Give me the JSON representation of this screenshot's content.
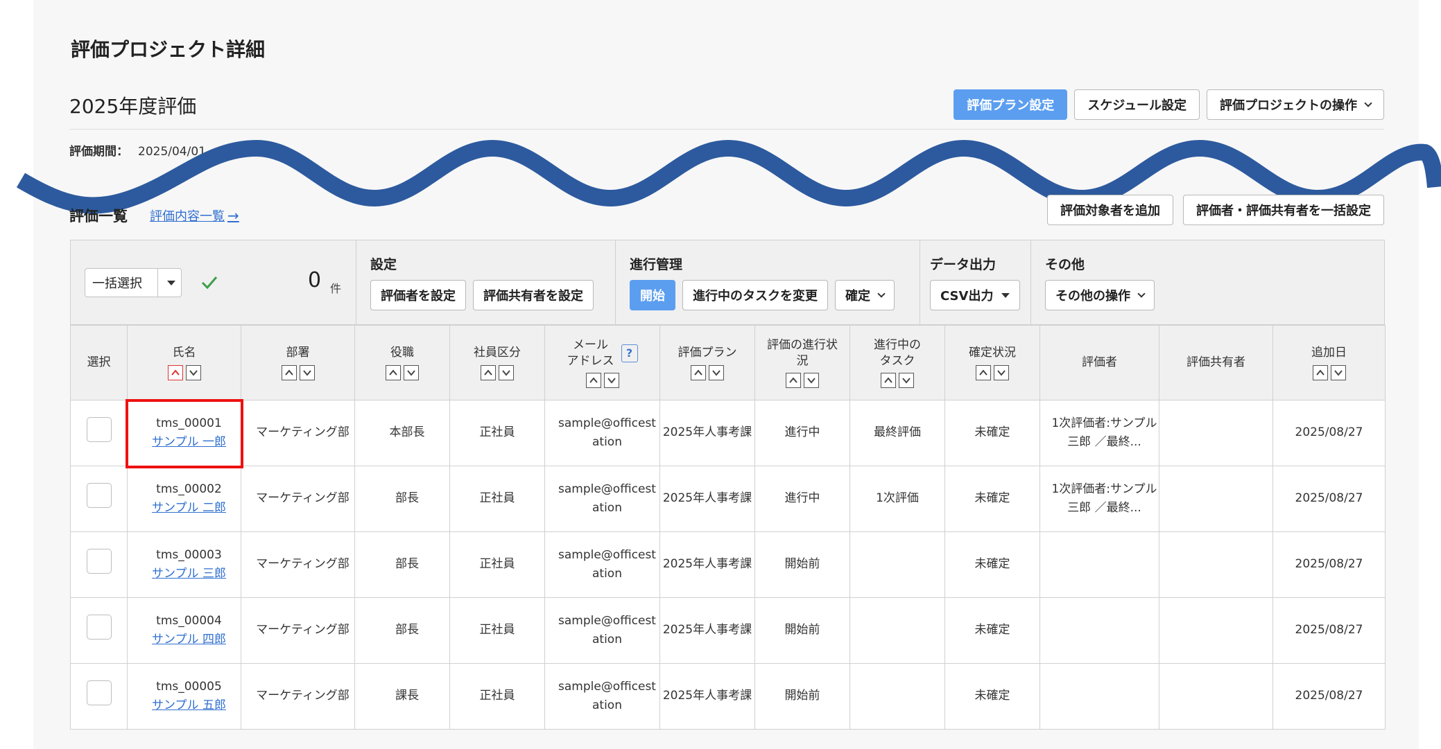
{
  "page_title": "評価プロジェクト詳細",
  "project": {
    "name": "2025年度評価",
    "period_label": "評価期間：",
    "period_value": "2025/04/01 ~2025/09/30"
  },
  "top_actions": {
    "plan_settings": "評価プラン設定",
    "schedule_settings": "スケジュール設定",
    "project_operations": "評価プロジェクトの操作"
  },
  "list": {
    "title": "評価一覧",
    "content_link": "評価内容一覧",
    "add_target": "評価対象者を追加",
    "bulk_set": "評価者・評価共有者を一括設定"
  },
  "toolbar": {
    "bulk_select": "一括選択",
    "count": "0",
    "count_unit": "件",
    "groups": {
      "settings": {
        "title": "設定",
        "set_evaluator": "評価者を設定",
        "set_sharer": "評価共有者を設定"
      },
      "progress": {
        "title": "進行管理",
        "start": "開始",
        "change_task": "進行中のタスクを変更",
        "confirm": "確定"
      },
      "export": {
        "title": "データ出力",
        "csv": "CSV出力"
      },
      "other": {
        "title": "その他",
        "other_ops": "その他の操作"
      }
    }
  },
  "columns": {
    "select": "選択",
    "name": "氏名",
    "department": "部署",
    "position": "役職",
    "employee_type": "社員区分",
    "email_line1": "メール",
    "email_line2": "アドレス",
    "plan": "評価プラン",
    "progress_line1": "評価の進行状",
    "progress_line2": "況",
    "task_line1": "進行中の",
    "task_line2": "タスク",
    "confirm_status": "確定状況",
    "evaluator": "評価者",
    "sharer": "評価共有者",
    "added_date": "追加日"
  },
  "rows": [
    {
      "id": "tms_00001",
      "name": "サンプル 一郎",
      "dept": "マーケティング部",
      "position": "本部長",
      "type": "正社員",
      "email": "sample@officestation",
      "plan": "2025年人事考課",
      "progress": "進行中",
      "task": "最終評価",
      "confirm": "未確定",
      "evaluator": "1次評価者:サンプル 三郎 ／最終...",
      "sharer": "",
      "date": "2025/08/27"
    },
    {
      "id": "tms_00002",
      "name": "サンプル 二郎",
      "dept": "マーケティング部",
      "position": "部長",
      "type": "正社員",
      "email": "sample@officestation",
      "plan": "2025年人事考課",
      "progress": "進行中",
      "task": "1次評価",
      "confirm": "未確定",
      "evaluator": "1次評価者:サンプル 三郎 ／最終...",
      "sharer": "",
      "date": "2025/08/27"
    },
    {
      "id": "tms_00003",
      "name": "サンプル 三郎",
      "dept": "マーケティング部",
      "position": "部長",
      "type": "正社員",
      "email": "sample@officestation",
      "plan": "2025年人事考課",
      "progress": "開始前",
      "task": "",
      "confirm": "未確定",
      "evaluator": "",
      "sharer": "",
      "date": "2025/08/27"
    },
    {
      "id": "tms_00004",
      "name": "サンプル 四郎",
      "dept": "マーケティング部",
      "position": "部長",
      "type": "正社員",
      "email": "sample@officestation",
      "plan": "2025年人事考課",
      "progress": "開始前",
      "task": "",
      "confirm": "未確定",
      "evaluator": "",
      "sharer": "",
      "date": "2025/08/27"
    },
    {
      "id": "tms_00005",
      "name": "サンプル 五郎",
      "dept": "マーケティング部",
      "position": "課長",
      "type": "正社員",
      "email": "sample@officestation",
      "plan": "2025年人事考課",
      "progress": "開始前",
      "task": "",
      "confirm": "未確定",
      "evaluator": "",
      "sharer": "",
      "date": "2025/08/27"
    }
  ],
  "colors": {
    "primary": "#5b9ef0",
    "link": "#2f6fd0",
    "highlight": "#e11111",
    "wave": "#2d5a9e"
  }
}
